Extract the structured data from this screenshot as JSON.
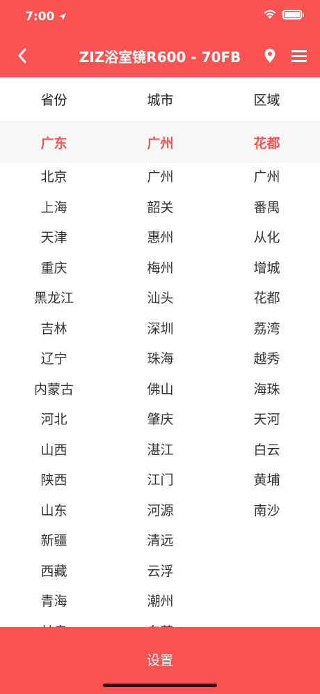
{
  "status_bar": {
    "time": "7:00"
  },
  "nav": {
    "title": "ZIZ浴室镜R600 - 70FB"
  },
  "headers": {
    "province": "省份",
    "city": "城市",
    "district": "区域"
  },
  "selected": {
    "province": "广东",
    "city": "广州",
    "district": "花都"
  },
  "provinces": [
    "北京",
    "上海",
    "天津",
    "重庆",
    "黑龙江",
    "吉林",
    "辽宁",
    "内蒙古",
    "河北",
    "山西",
    "陕西",
    "山东",
    "新疆",
    "西藏",
    "青海",
    "甘肃"
  ],
  "cities": [
    "广州",
    "韶关",
    "惠州",
    "梅州",
    "汕头",
    "深圳",
    "珠海",
    "佛山",
    "肇庆",
    "湛江",
    "江门",
    "河源",
    "清远",
    "云浮",
    "潮州",
    "东莞"
  ],
  "districts": [
    "广州",
    "番禺",
    "从化",
    "增城",
    "花都",
    "荔湾",
    "越秀",
    "海珠",
    "天河",
    "白云",
    "黄埔",
    "南沙"
  ],
  "footer": {
    "button_label": "设置"
  },
  "colors": {
    "accent": "#fb5252",
    "selected_bg": "#f7f7f7"
  }
}
